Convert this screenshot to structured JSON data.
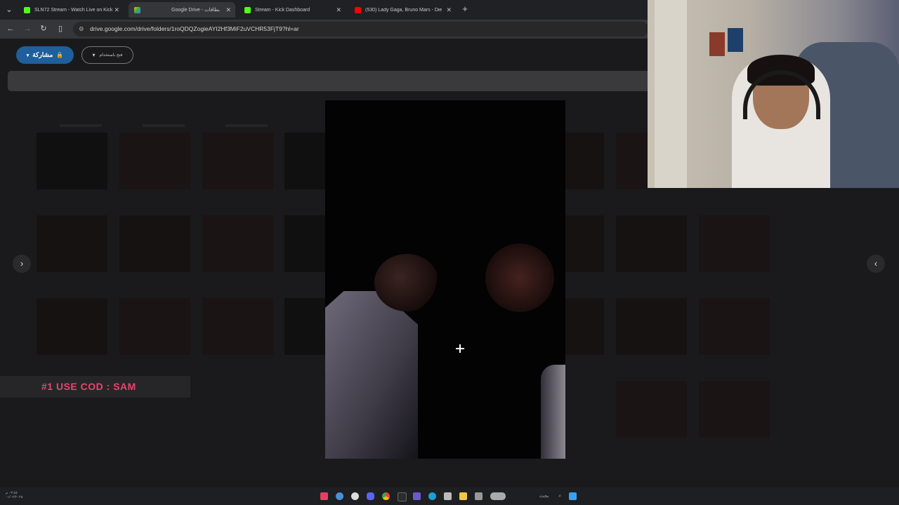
{
  "tabs": [
    {
      "title": "SLN72 Stream - Watch Live on Kick",
      "color": "#53fc18",
      "active": false
    },
    {
      "title": "Google Drive - بطاقات",
      "color": "#fbbc04",
      "active": true
    },
    {
      "title": "Stream - Kick Dashboard",
      "color": "#53fc18",
      "active": false
    },
    {
      "title": "(530) Lady Gaga, Bruno Mars - Die With A...",
      "color": "#ff0000",
      "active": false
    }
  ],
  "new_tab_icon": "plus-icon",
  "url": "drive.google.com/drive/folders/1roQDQZogieAYI2Hf3MiF2uVCHR53FjT9?hl=ar",
  "drive": {
    "share_label": "مشاركة",
    "open_with_label": "فتح باستخدام"
  },
  "overlay": {
    "promo_text": "#1 USE COD : SAM"
  },
  "taskbar": {
    "search_label": "بحث",
    "time": "٠٣:٤٥ م",
    "date": "٠١/٠٢/٢٠٢٥"
  },
  "colors": {
    "share_button": "#1f5f9b",
    "promo_text": "#e8456e"
  }
}
